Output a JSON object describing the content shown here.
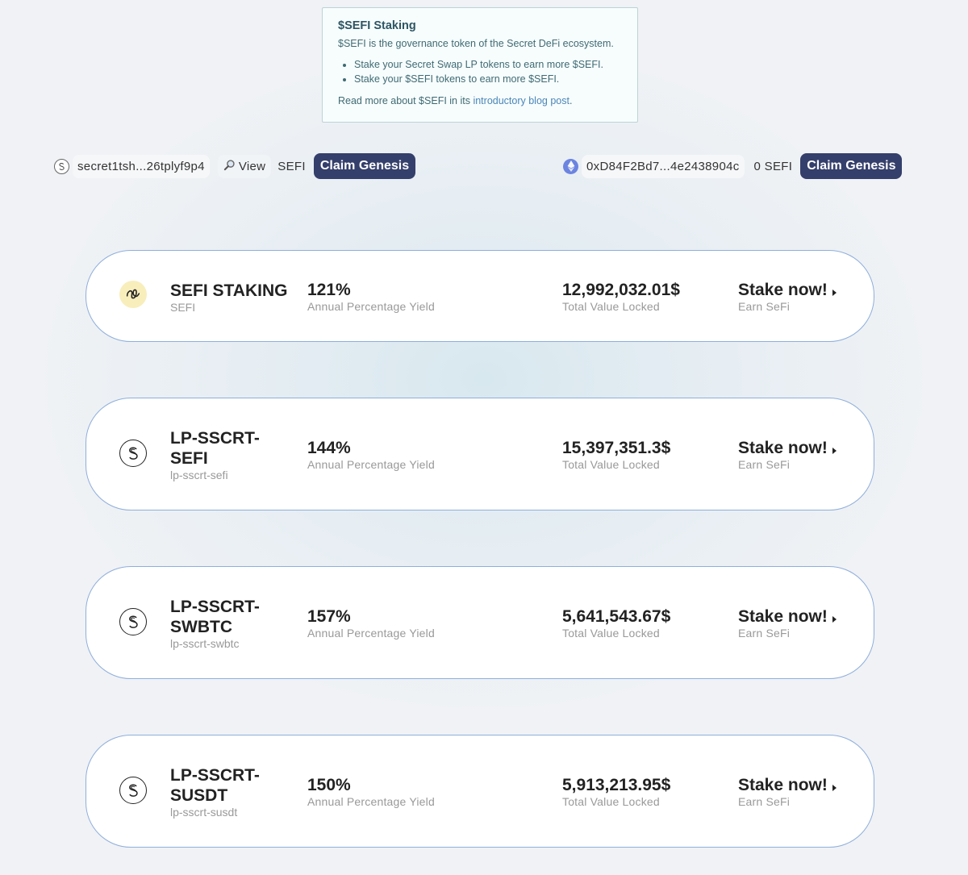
{
  "info": {
    "title": "$SEFI Staking",
    "description": "$SEFI is the governance token of the Secret DeFi ecosystem.",
    "bullets": [
      "Stake your Secret Swap LP tokens to earn more $SEFI.",
      "Stake your $SEFI tokens to earn more $SEFI."
    ],
    "read_more_prefix": "Read more about $SEFI in its ",
    "read_more_link": "introductory blog post",
    "read_more_suffix": "."
  },
  "wallet_secret": {
    "icon": "secret-network-icon",
    "address": "secret1tsh...26tplyf9p4",
    "view_label": "View",
    "view_icon": "magnifier-icon",
    "balance": "SEFI",
    "claim_label": "Claim Genesis"
  },
  "wallet_eth": {
    "icon": "ethereum-icon",
    "address": "0xD84F2Bd7...4e2438904c",
    "balance": "0 SEFI",
    "claim_label": "Claim Genesis"
  },
  "colors": {
    "accent_button": "#353f6b",
    "card_border": "#8eaedc",
    "info_text": "#3f6a73",
    "link": "#4a86b8"
  },
  "pools": [
    {
      "icon": "sefi-token-icon",
      "title": "SEFI STAKING",
      "symbol": "SEFI",
      "apy": "121%",
      "apy_label": "Annual Percentage Yield",
      "tvl": "12,992,032.01$",
      "tvl_label": "Total Value Locked",
      "action": "Stake now!",
      "action_sub": "Earn SeFi"
    },
    {
      "icon": "secret-network-icon",
      "title": "LP-SSCRT-SEFI",
      "symbol": "lp-sscrt-sefi",
      "apy": "144%",
      "apy_label": "Annual Percentage Yield",
      "tvl": "15,397,351.3$",
      "tvl_label": "Total Value Locked",
      "action": "Stake now!",
      "action_sub": "Earn SeFi"
    },
    {
      "icon": "secret-network-icon",
      "title": "LP-SSCRT-SWBTC",
      "symbol": "lp-sscrt-swbtc",
      "apy": "157%",
      "apy_label": "Annual Percentage Yield",
      "tvl": "5,641,543.67$",
      "tvl_label": "Total Value Locked",
      "action": "Stake now!",
      "action_sub": "Earn SeFi"
    },
    {
      "icon": "secret-network-icon",
      "title": "LP-SSCRT-SUSDT",
      "symbol": "lp-sscrt-susdt",
      "apy": "150%",
      "apy_label": "Annual Percentage Yield",
      "tvl": "5,913,213.95$",
      "tvl_label": "Total Value Locked",
      "action": "Stake now!",
      "action_sub": "Earn SeFi"
    }
  ]
}
